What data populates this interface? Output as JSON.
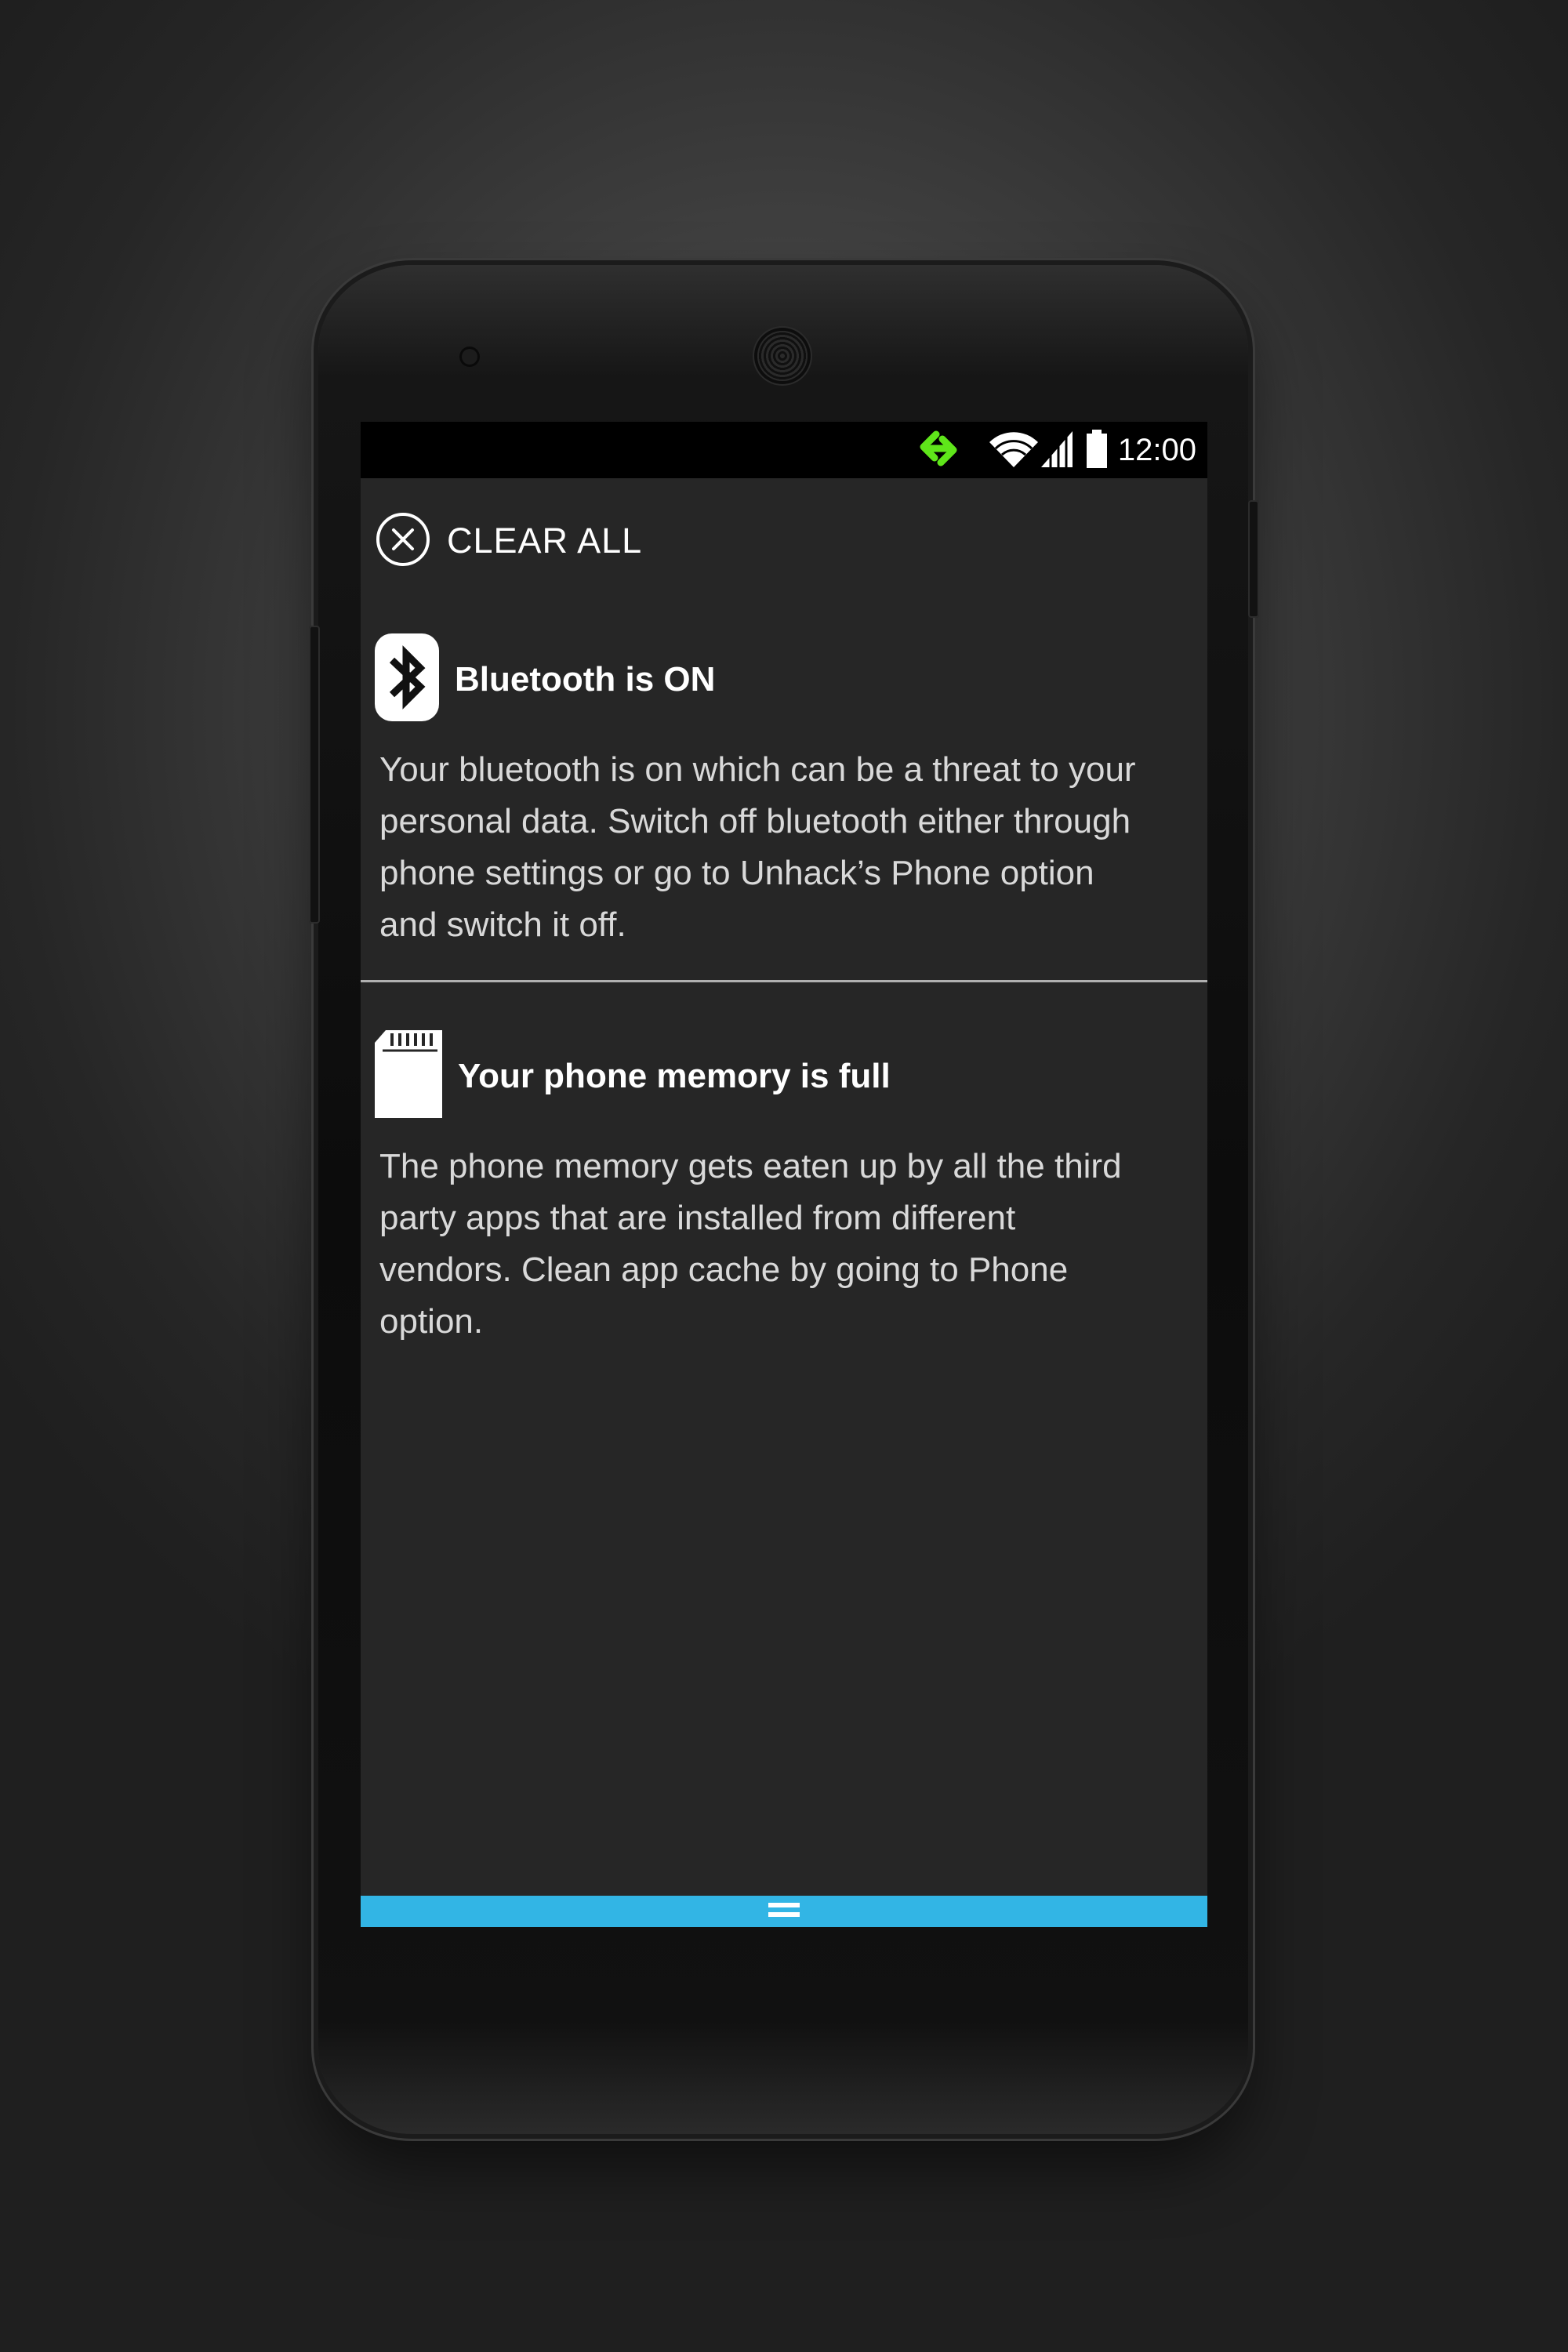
{
  "status_bar": {
    "time": "12:00",
    "icons": [
      "unhack-link-icon",
      "wifi-icon",
      "signal-icon",
      "battery-icon"
    ],
    "app_icon_color": "#5fe61a"
  },
  "clear_all": {
    "label": "CLEAR ALL",
    "icon": "close-circle-icon"
  },
  "notifications": [
    {
      "icon": "bluetooth-icon",
      "title": "Bluetooth is ON",
      "body": "Your bluetooth is on which can be a threat to your personal data. Switch off bluetooth either through phone settings or go to Unhack’s Phone option and switch it off."
    },
    {
      "icon": "sd-card-icon",
      "title": "Your phone memory is full",
      "body": "The phone memory gets eaten up by all the third party apps that are installed from different vendors. Clean app cache by going to Phone option."
    }
  ],
  "bottom_bar": {
    "color": "#32b5e5",
    "icon": "drag-handle-icon"
  }
}
